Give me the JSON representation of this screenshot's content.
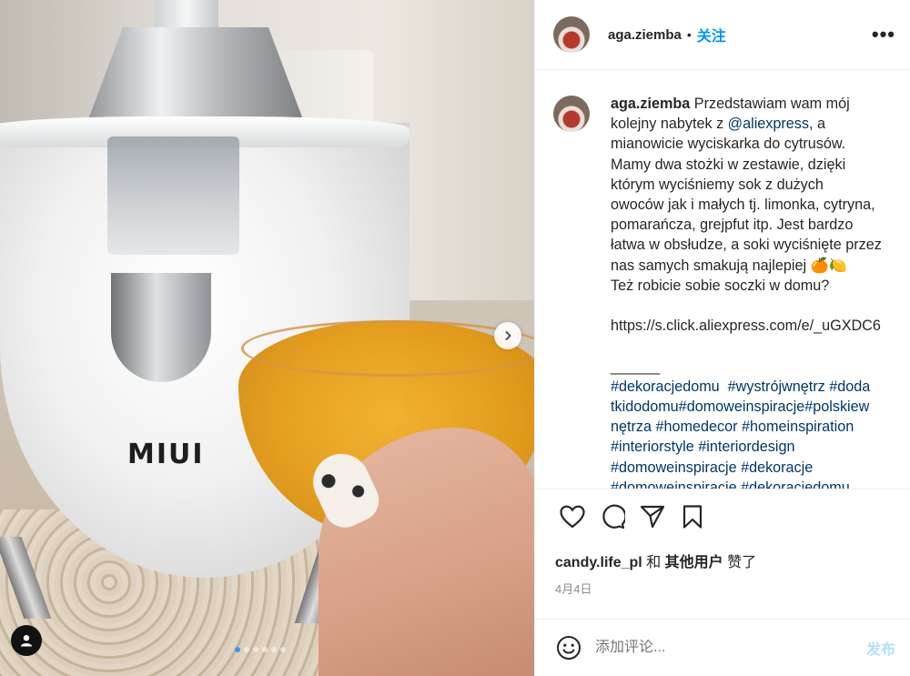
{
  "media": {
    "brand_text": "MIUI",
    "carousel": {
      "count": 6,
      "active_index": 0
    }
  },
  "header": {
    "username": "aga.ziemba",
    "separator": "•",
    "follow_label": "关注",
    "more_label": "•••"
  },
  "caption": {
    "username": "aga.ziemba",
    "lines": [
      {
        "text": "Przedstawiam wam mój"
      },
      {
        "text": "kolejny nabytek z ",
        "link": "@aliexpress",
        "after": ", a"
      },
      {
        "text": "mianowicie wyciskarka do cytrusów."
      },
      {
        "text": "Mamy dwa stożki w zestawie, dzięki"
      },
      {
        "text": "którym wyciśniemy sok z dużych"
      },
      {
        "text": "owoców jak i małych tj. limonka, cytryna,"
      },
      {
        "text": "pomarańcza, grejpfut itp. Jest bardzo"
      },
      {
        "text": "łatwa w obsłudze, a soki wyciśnięte przez"
      },
      {
        "text": "nas samych smakują najlepiej 🍊🍋"
      },
      {
        "text": "Też robicie sobie soczki w domu?"
      },
      {
        "text": " "
      },
      {
        "text": "https://s.click.aliexpress.com/e/_uGXDC6"
      },
      {
        "text": " "
      },
      {
        "text": "______"
      },
      {
        "link": "#dekoracjedomu  #wystrójwnętrz #doda"
      },
      {
        "link": "tkidodomu#domoweinspiracje#polskiew"
      },
      {
        "link": "nętrza #homedecor #homeinspiration"
      },
      {
        "link": "#interiorstyle #interiordesign"
      },
      {
        "link": "#domoweinspiracje #dekoracje"
      },
      {
        "link": "#domoweinspiracje #dekoracjedomu"
      }
    ]
  },
  "actions": {
    "like_icon": "heart-icon",
    "comment_icon": "comment-icon",
    "share_icon": "paper-plane-icon",
    "save_icon": "bookmark-icon"
  },
  "likes": {
    "user": "candy.life_pl",
    "connector": "和",
    "others": "其他用户",
    "suffix": "赞了"
  },
  "date": "4月4日",
  "add_comment": {
    "emoji_icon": "smiley-icon",
    "placeholder": "添加评论...",
    "post_label": "发布"
  },
  "colors": {
    "accent": "#0095f6",
    "link": "#00376b",
    "post_disabled": "#b2dffc",
    "muted": "#8e8e8e"
  }
}
